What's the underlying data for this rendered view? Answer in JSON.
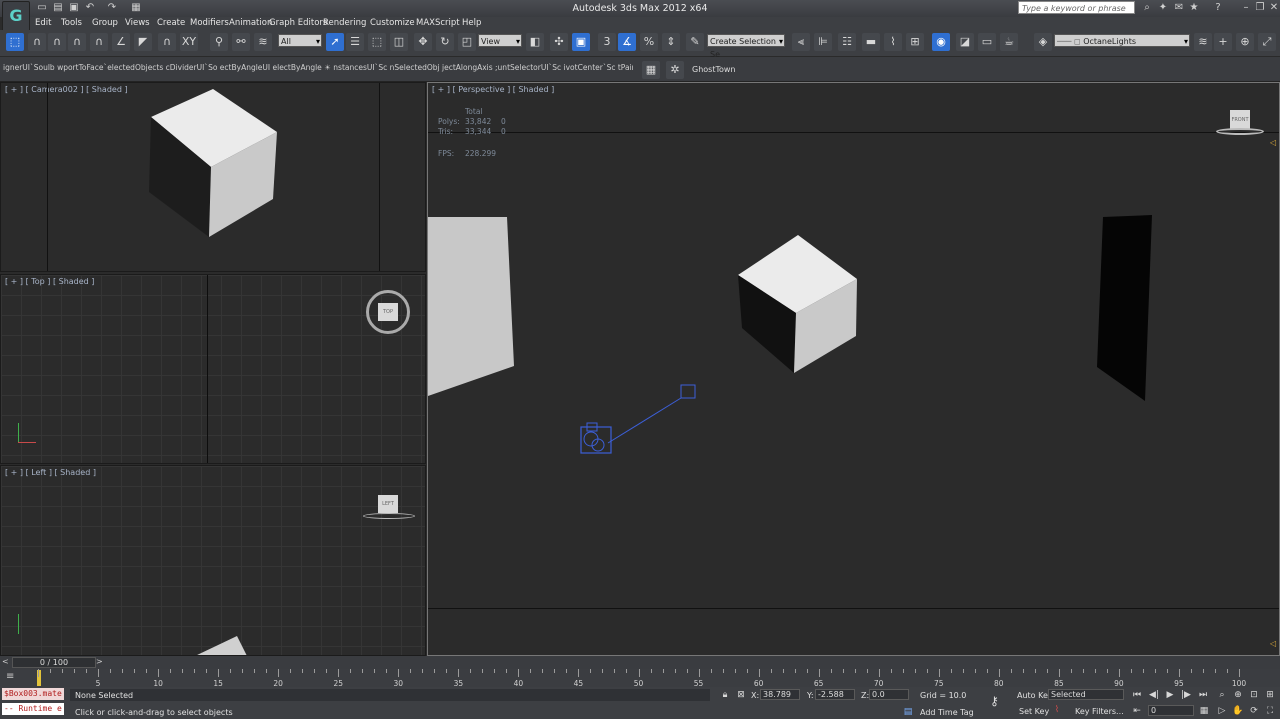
{
  "title_bar": {
    "title": "Autodesk 3ds Max  2012 x64",
    "search_placeholder": "Type a keyword or phrase"
  },
  "menu": [
    "Edit",
    "Tools",
    "Group",
    "Views",
    "Create",
    "Modifiers",
    "Animation",
    "Graph Editors",
    "Rendering",
    "Customize",
    "MAXScript",
    "Help"
  ],
  "toolbar": {
    "selection_filter": "All",
    "reference_coord": "View",
    "selection_set": "Create Selection Se",
    "layer": "OctaneLights"
  },
  "script_toolbar": {
    "strip_text": "ignerUI`Soulb wportToFace`electedObjects cDividerUI`So ectByAngleUI electByAngle  ☀ nstancesUI`Sc nSelectedObj jectAlongAxis ;untSelectorUI`Sc ivotCenter`Sc tPainterUI`Sc formReset`Sc",
    "ghosttown_label": "GhostTown"
  },
  "viewports": {
    "camera": {
      "label": "[ + ] [ Camera002 ] [ Shaded ]"
    },
    "top": {
      "label": "[ + ] [ Top ] [ Shaded ]",
      "viewcube": "TOP"
    },
    "left": {
      "label": "[ + ] [ Left ] [ Shaded ]",
      "viewcube": "LEFT"
    },
    "perspective": {
      "label": "[ + ] [ Perspective ] [ Shaded ]",
      "viewcube": "FRONT",
      "stats": {
        "total_header": "Total",
        "polys_label": "Polys:",
        "polys_total": "33,842",
        "polys_sel": "0",
        "tris_label": "Tris:",
        "tris_total": "33,344",
        "tris_sel": "0",
        "fps_label": "FPS:",
        "fps_value": "228.299"
      }
    }
  },
  "timeline": {
    "slider": "0 / 100",
    "ticks": [
      "5",
      "10",
      "15",
      "20",
      "25",
      "30",
      "35",
      "40",
      "45",
      "50",
      "55",
      "60",
      "65",
      "70",
      "75",
      "80",
      "85",
      "90",
      "95",
      "100"
    ]
  },
  "status": {
    "script_line1": "$Box003.mate",
    "script_line2": "-- Runtime e",
    "selection": "None Selected",
    "prompt": "Click or click-and-drag to select objects",
    "x_label": "X:",
    "x_value": "38.789",
    "y_label": "Y:",
    "y_value": "-2.588",
    "z_label": "Z:",
    "z_value": "0.0",
    "grid": "Grid = 10.0",
    "add_time_tag": "Add Time Tag",
    "auto_key": "Auto Key",
    "set_key": "Set Key",
    "key_mode": "Selected",
    "key_filters": "Key Filters...",
    "frame": "0"
  },
  "colors": {
    "accent": "#2f6fd1",
    "viewport_bg": "#2b2b2b",
    "chrome": "#3d3f43"
  }
}
